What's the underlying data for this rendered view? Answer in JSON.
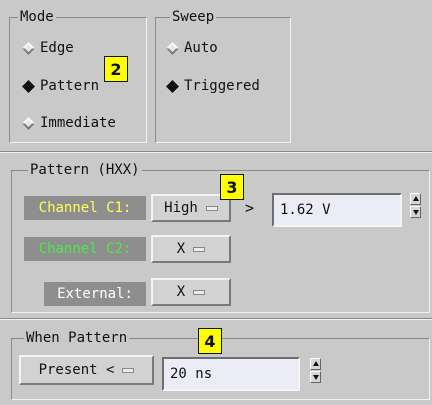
{
  "mode": {
    "title": "Mode",
    "options": [
      {
        "label": "Edge",
        "selected": false
      },
      {
        "label": "Pattern",
        "selected": true
      },
      {
        "label": "Immediate",
        "selected": false
      }
    ]
  },
  "sweep": {
    "title": "Sweep",
    "options": [
      {
        "label": "Auto",
        "selected": false
      },
      {
        "label": "Triggered",
        "selected": true
      }
    ]
  },
  "pattern": {
    "title": "Pattern (HXX)",
    "rows": [
      {
        "label": "Channel C1:",
        "label_color": "#ffff55",
        "value": "High"
      },
      {
        "label": "Channel C2:",
        "label_color": "#44ee44",
        "value": "X"
      },
      {
        "label": "External:",
        "label_color": "#ffffff",
        "value": "X"
      }
    ],
    "operator": ">",
    "level_value": "1.62 V"
  },
  "when_pattern": {
    "title": "When Pattern",
    "qualifier": "Present <",
    "duration_value": "20 ns"
  },
  "callouts": [
    "2",
    "3",
    "4"
  ],
  "icons": {
    "radio_off": "diamond-radio-unselected",
    "radio_on": "diamond-radio-selected",
    "spinner": "up-down-arrow-spinner",
    "menu_indicator": "option-menu-dash"
  }
}
